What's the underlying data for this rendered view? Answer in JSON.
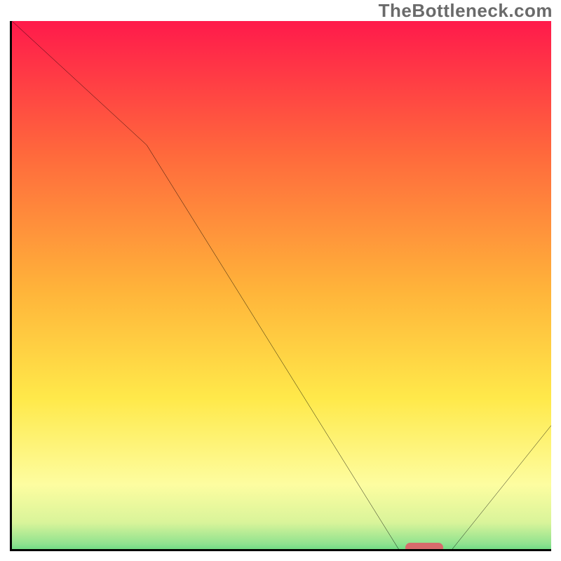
{
  "watermark": "TheBottleneck.com",
  "chart_data": {
    "type": "line",
    "title": "",
    "xlabel": "",
    "ylabel": "",
    "xlim": [
      0,
      100
    ],
    "ylim": [
      0,
      100
    ],
    "grid": false,
    "legend": false,
    "series": [
      {
        "name": "bottleneck-curve",
        "x": [
          0,
          25,
          73,
          80,
          100
        ],
        "y": [
          100,
          77,
          0,
          0,
          25
        ]
      }
    ],
    "annotations": [
      {
        "name": "optimal-range-marker",
        "shape": "rounded-bar",
        "x_start": 73,
        "x_end": 80,
        "y": 0,
        "color": "#d86b6c"
      }
    ],
    "background_gradient": {
      "type": "vertical",
      "stops": [
        {
          "pct": 0,
          "color": "#ff1a4b"
        },
        {
          "pct": 25,
          "color": "#ff6a3c"
        },
        {
          "pct": 50,
          "color": "#ffb43a"
        },
        {
          "pct": 70,
          "color": "#ffe94a"
        },
        {
          "pct": 86,
          "color": "#fdfda0"
        },
        {
          "pct": 93,
          "color": "#d9f49a"
        },
        {
          "pct": 97,
          "color": "#8fe28f"
        },
        {
          "pct": 100,
          "color": "#2fcf6c"
        }
      ]
    }
  }
}
